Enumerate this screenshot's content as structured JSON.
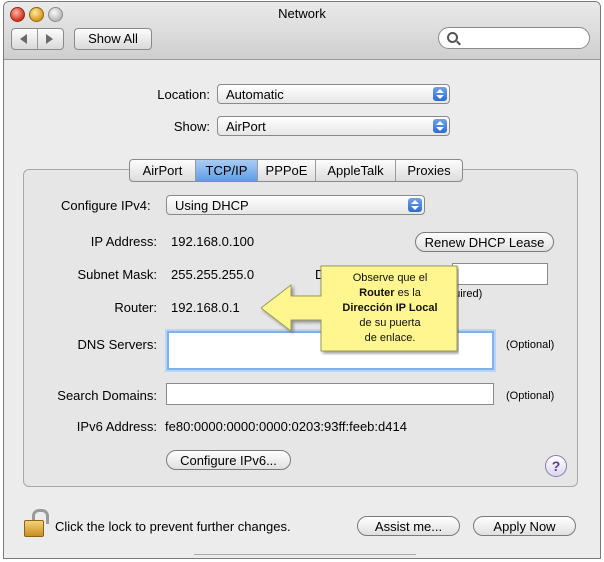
{
  "window": {
    "title": "Network"
  },
  "toolbar": {
    "show_all": "Show All",
    "search_value": ""
  },
  "location": {
    "label": "Location:",
    "value": "Automatic"
  },
  "show": {
    "label": "Show:",
    "value": "AirPort"
  },
  "tabs": [
    {
      "label": "AirPort",
      "active": false
    },
    {
      "label": "TCP/IP",
      "active": true
    },
    {
      "label": "PPPoE",
      "active": false
    },
    {
      "label": "AppleTalk",
      "active": false
    },
    {
      "label": "Proxies",
      "active": false
    }
  ],
  "tcpip": {
    "configure_label": "Configure IPv4:",
    "configure_value": "Using DHCP",
    "ip_label": "IP Address:",
    "ip_value": "192.168.0.100",
    "renew_button": "Renew DHCP Lease",
    "subnet_label": "Subnet Mask:",
    "subnet_value": "255.255.255.0",
    "dhcp_id_label_partial": "D",
    "dhcp_required_partial": "quired)",
    "router_label": "Router:",
    "router_value": "192.168.0.1",
    "dns_label": "DNS Servers:",
    "dns_optional": "(Optional)",
    "search_label": "Search Domains:",
    "search_optional": "(Optional)",
    "ipv6_label": "IPv6 Address:",
    "ipv6_value": "fe80:0000:0000:0000:0203:93ff:feeb:d414",
    "configure_ipv6_button": "Configure IPv6...",
    "help_glyph": "?"
  },
  "callout": {
    "line1": "Observe que el",
    "router_bold": "Router",
    "line2_rest": " es la",
    "line3_bold": "Dirección IP Local",
    "line4": "de su puerta",
    "line5": "de enlace."
  },
  "footer": {
    "lock_text": "Click the lock to prevent further changes.",
    "assist_button": "Assist me...",
    "apply_button": "Apply Now"
  },
  "colors": {
    "callout_fill": "#fff68f",
    "tab_active": "#7fb2ee",
    "focus_ring": "#7fb0ea"
  },
  "icons": [
    "close-light",
    "minimize-light",
    "zoom-light",
    "back-arrow-icon",
    "forward-arrow-icon",
    "search-icon",
    "stepper-icon",
    "help-icon",
    "lock-icon"
  ]
}
